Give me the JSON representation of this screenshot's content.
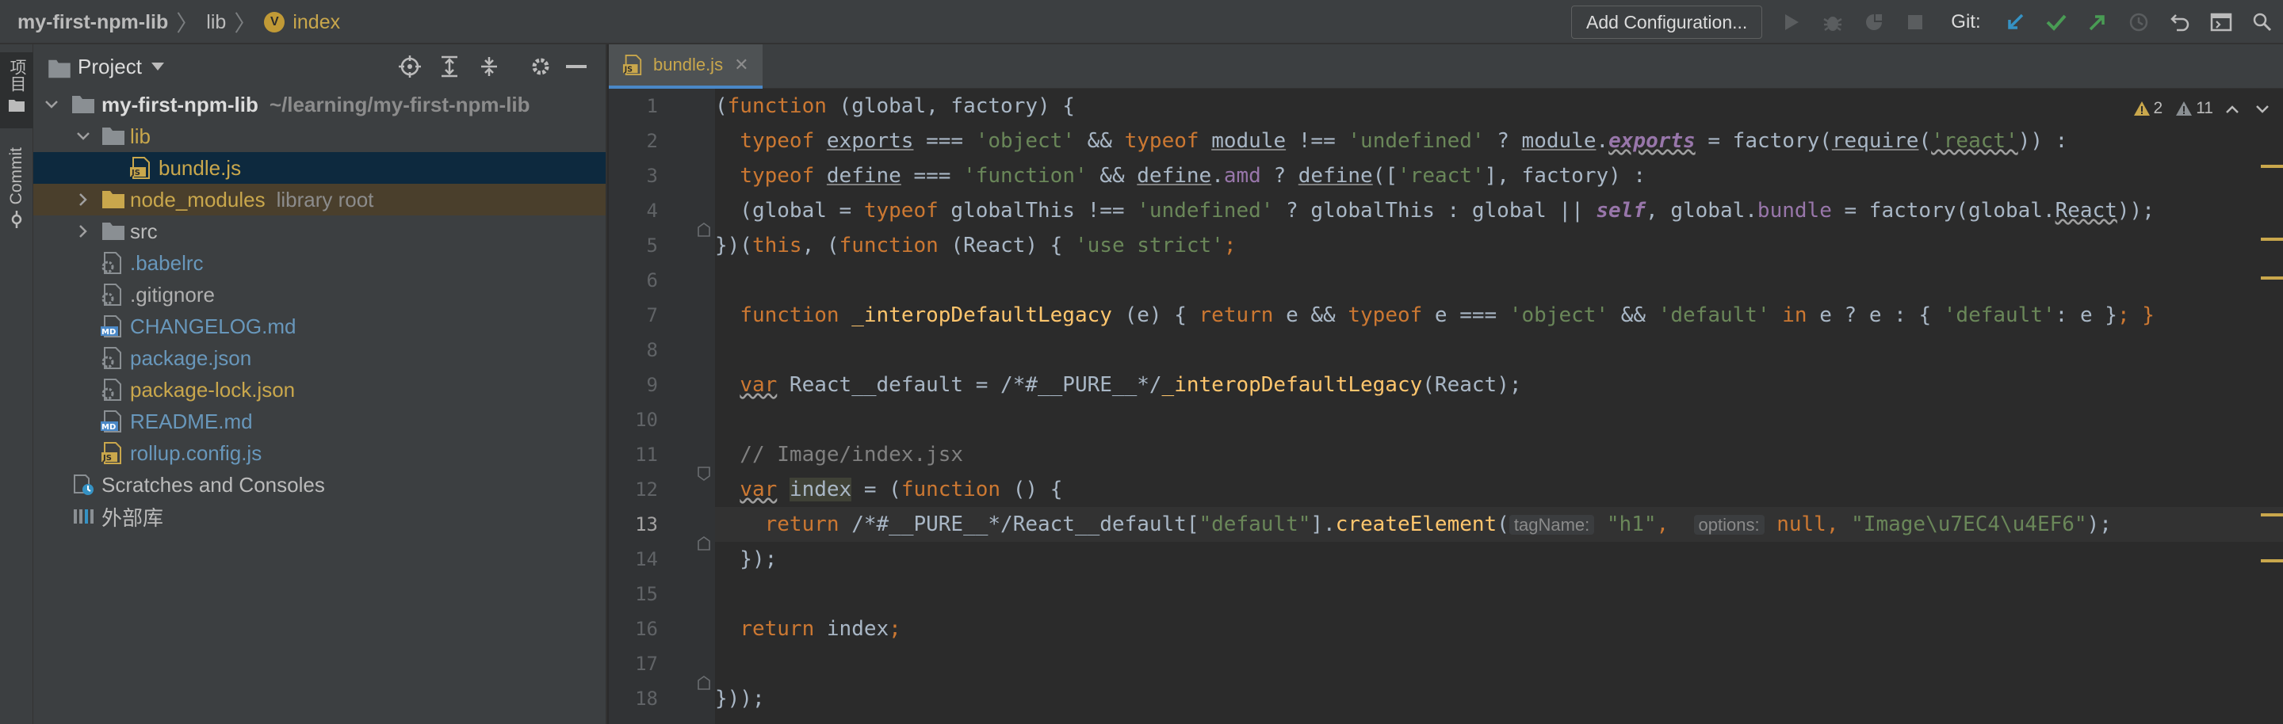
{
  "breadcrumb": {
    "project": "my-first-npm-lib",
    "folder": "lib",
    "file": "index"
  },
  "toolbar": {
    "add_configuration": "Add Configuration...",
    "git_label": "Git:"
  },
  "tool_strip": {
    "project_tab": "项目",
    "commit_tab": "Commit"
  },
  "project_panel": {
    "title": "Project",
    "tree": [
      {
        "label": "my-first-npm-lib",
        "hint": "~/learning/my-first-npm-lib",
        "type": "project-root"
      },
      {
        "label": "lib",
        "type": "folder"
      },
      {
        "label": "bundle.js",
        "type": "js-file"
      },
      {
        "label": "node_modules",
        "hint": "library root",
        "type": "folder"
      },
      {
        "label": "src",
        "type": "folder"
      },
      {
        "label": ".babelrc",
        "type": "config-file"
      },
      {
        "label": ".gitignore",
        "type": "text-file"
      },
      {
        "label": "CHANGELOG.md",
        "type": "md-file"
      },
      {
        "label": "package.json",
        "type": "config-file"
      },
      {
        "label": "package-lock.json",
        "type": "config-file"
      },
      {
        "label": "README.md",
        "type": "md-file"
      },
      {
        "label": "rollup.config.js",
        "type": "js-file"
      },
      {
        "label": "Scratches and Consoles",
        "type": "scratches"
      },
      {
        "label": "外部库",
        "type": "libraries"
      }
    ]
  },
  "editor": {
    "tab_label": "bundle.js",
    "warnings_count": "2",
    "weak_warnings_count": "11",
    "line_numbers": [
      "1",
      "2",
      "3",
      "4",
      "5",
      "6",
      "7",
      "8",
      "9",
      "10",
      "11",
      "12",
      "13",
      "14",
      "15",
      "16",
      "17",
      "18"
    ],
    "current_line": "13",
    "code": {
      "l1": [
        "(",
        "function",
        " (global, factory) {"
      ],
      "l2": [
        "  ",
        "typeof",
        " ",
        "exports",
        " === ",
        "'object'",
        " && ",
        "typeof",
        " ",
        "module",
        " !== ",
        "'undefined'",
        " ? ",
        "module",
        ".",
        "exports",
        " = factory(",
        "require",
        "(",
        "'react'",
        ")) :"
      ],
      "l3": [
        "  ",
        "typeof",
        " ",
        "define",
        " === ",
        "'function'",
        " && ",
        "define",
        ".",
        "amd",
        " ? ",
        "define",
        "([",
        "'react'",
        "], factory) :"
      ],
      "l4": [
        "  (global = ",
        "typeof",
        " globalThis !== ",
        "'undefined'",
        " ? globalThis : global || ",
        "self",
        ", global.",
        "bundle",
        " = factory(global.",
        "React",
        "));"
      ],
      "l5": [
        "})(",
        "this",
        ", (",
        "function",
        " (React) { ",
        "'use strict'",
        ";"
      ],
      "l6": [
        ""
      ],
      "l7": [
        "  ",
        "function",
        " ",
        "_interopDefaultLegacy",
        " (e) { ",
        "return",
        " e && ",
        "typeof",
        " e === ",
        "'object'",
        " && ",
        "'default'",
        " ",
        "in",
        " e ? e : { ",
        "'default'",
        ": e }",
        "; }"
      ],
      "l8": [
        ""
      ],
      "l9": [
        "  ",
        "var",
        " React__default = /*#__PURE__*/",
        "_interopDefaultLegacy",
        "(React);"
      ],
      "l10": [
        ""
      ],
      "l11": [
        "  // Image/index.jsx"
      ],
      "l12": [
        "  ",
        "var",
        " ",
        "index",
        " = (",
        "function",
        " () {"
      ],
      "l13": [
        "    ",
        "return",
        " /*#__PURE__*/React__default[",
        "\"default\"",
        "].",
        "createElement",
        "(",
        "tagName:",
        " ",
        "\"h1\"",
        ",  ",
        "options:",
        " ",
        "null",
        ", ",
        "\"Image\\u7EC4\\u4EF6\"",
        ");"
      ],
      "l14": [
        "  });"
      ],
      "l15": [
        ""
      ],
      "l16": [
        "  ",
        "return",
        " index",
        ";"
      ],
      "l17": [
        ""
      ],
      "l18": [
        "}));"
      ]
    }
  },
  "colors": {
    "accent": "#4a88c7",
    "keyword": "#cc7832",
    "string": "#6a8759",
    "function": "#ffc66d"
  }
}
